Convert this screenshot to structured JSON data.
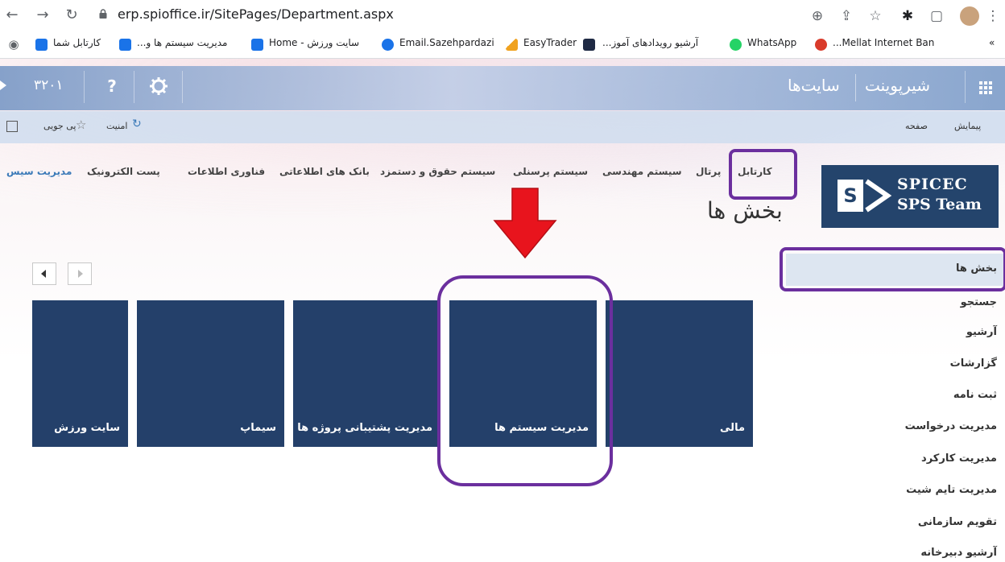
{
  "browser": {
    "url": "erp.spioffice.ir/SitePages/Department.aspx",
    "bookmarks": [
      {
        "label": "کارتابل شما"
      },
      {
        "label": "مدیریت سیستم ها و..."
      },
      {
        "label": "سایت ورزش - Home"
      },
      {
        "label": "Email.Sazehpardazi"
      },
      {
        "label": "EasyTrader"
      },
      {
        "label": "آرشیو رویدادهای آموز..."
      },
      {
        "label": "WhatsApp"
      },
      {
        "label": "Mellat Internet Ban..."
      }
    ],
    "more_bookmarks": "»"
  },
  "suite": {
    "app_name": "شیرپوینت",
    "sites": "سایت‌ها",
    "number": "۳۲۰۱",
    "help": "?"
  },
  "ribbon": {
    "browse": "پیمایش",
    "page": "صفحه",
    "security": "امنیت",
    "follow": "پی جویی"
  },
  "topnav": [
    "کارتابل",
    "پرتال",
    "سیستم مهندسی",
    "سیستم پرسنلی",
    "سیستم حقوق و دستمزد",
    "بانک های اطلاعاتی",
    "فناوری اطلاعات",
    "پست الکترونیک",
    "مدیریت سیس"
  ],
  "logo": {
    "letter": "S",
    "line1": "SPICEC",
    "line2": "SPS Team"
  },
  "page_title": "بخش ها",
  "sidebar": [
    "بخش ها",
    "جستجو",
    "آرشیو",
    "گزارشات",
    "ثبت نامه",
    "مدیریت درخواست",
    "مدیریت کارکرد",
    "مدیریت تایم شیت",
    "تقویم سازمانی",
    "آرشیو دبیرخانه"
  ],
  "tiles": [
    "مالی",
    "مدیریت سیستم ها",
    "مدیریت پشتیبانی پروژه ها",
    "سیماپ",
    "سایت ورزش"
  ],
  "colors": {
    "tile": "#24406a",
    "highlight": "#6b2f9e",
    "arrow": "#e8141d",
    "logo_bg": "#24446c"
  }
}
